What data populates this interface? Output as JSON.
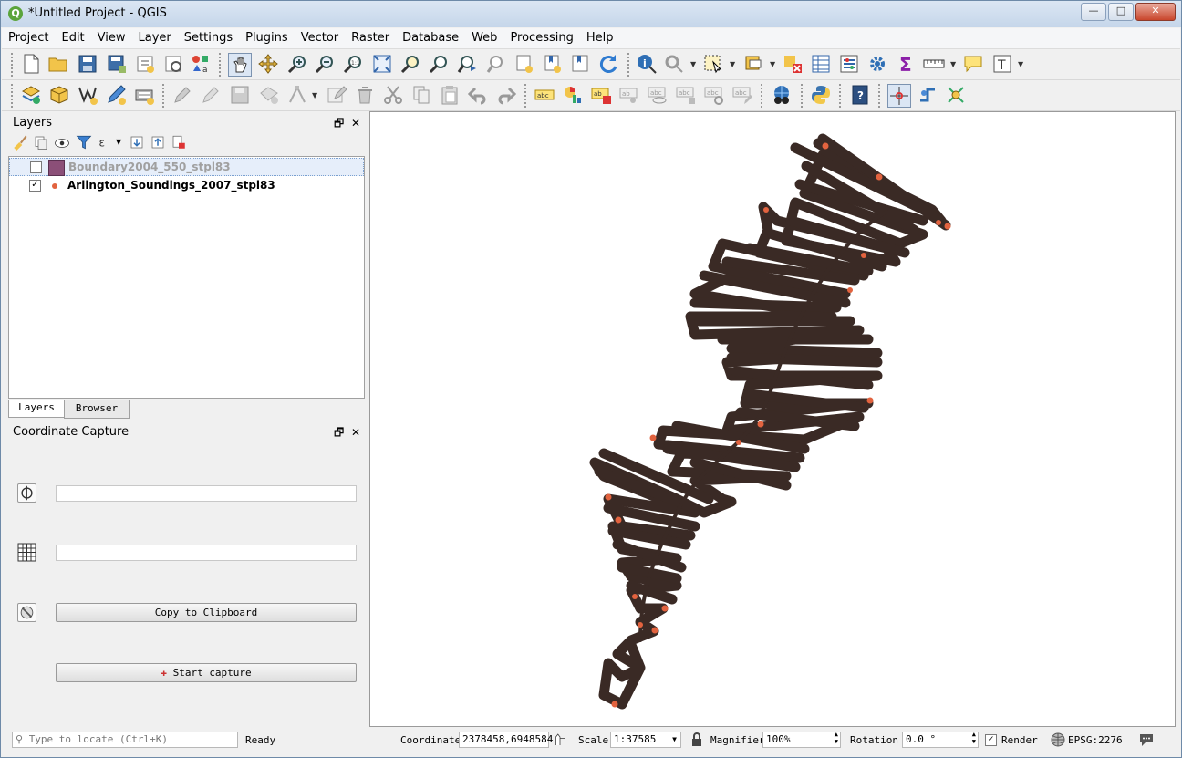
{
  "window": {
    "title": "*Untitled Project - QGIS"
  },
  "menu": [
    "Project",
    "Edit",
    "View",
    "Layer",
    "Settings",
    "Plugins",
    "Vector",
    "Raster",
    "Database",
    "Web",
    "Processing",
    "Help"
  ],
  "layers_panel": {
    "title": "Layers",
    "layers": [
      {
        "name": "Boundary2004_550_stpl83",
        "checked": false,
        "swatch": "#8b4f78"
      },
      {
        "name": "Arlington_Soundings_2007_stpl83",
        "checked": true,
        "swatch": "#e2633f"
      }
    ],
    "tabs": [
      "Layers",
      "Browser"
    ]
  },
  "coordinate_capture": {
    "title": "Coordinate Capture",
    "field1_value": "",
    "field2_value": "",
    "copy_label": "Copy to Clipboard",
    "start_label": "Start capture"
  },
  "status_bar": {
    "locator_placeholder": "Type to locate (Ctrl+K)",
    "ready": "Ready",
    "coordinate_label": "Coordinate",
    "coordinate_value": "2378458,6948584",
    "scale_label": "Scale",
    "scale_value": "1:37585",
    "magnifier_label": "Magnifier",
    "magnifier_value": "100%",
    "rotation_label": "Rotation",
    "rotation_value": "0.0 °",
    "render_label": "Render",
    "crs": "EPSG:2276"
  },
  "colors": {
    "track": "#3a2a25",
    "point": "#e2633f",
    "accent": "#5ba43b"
  }
}
